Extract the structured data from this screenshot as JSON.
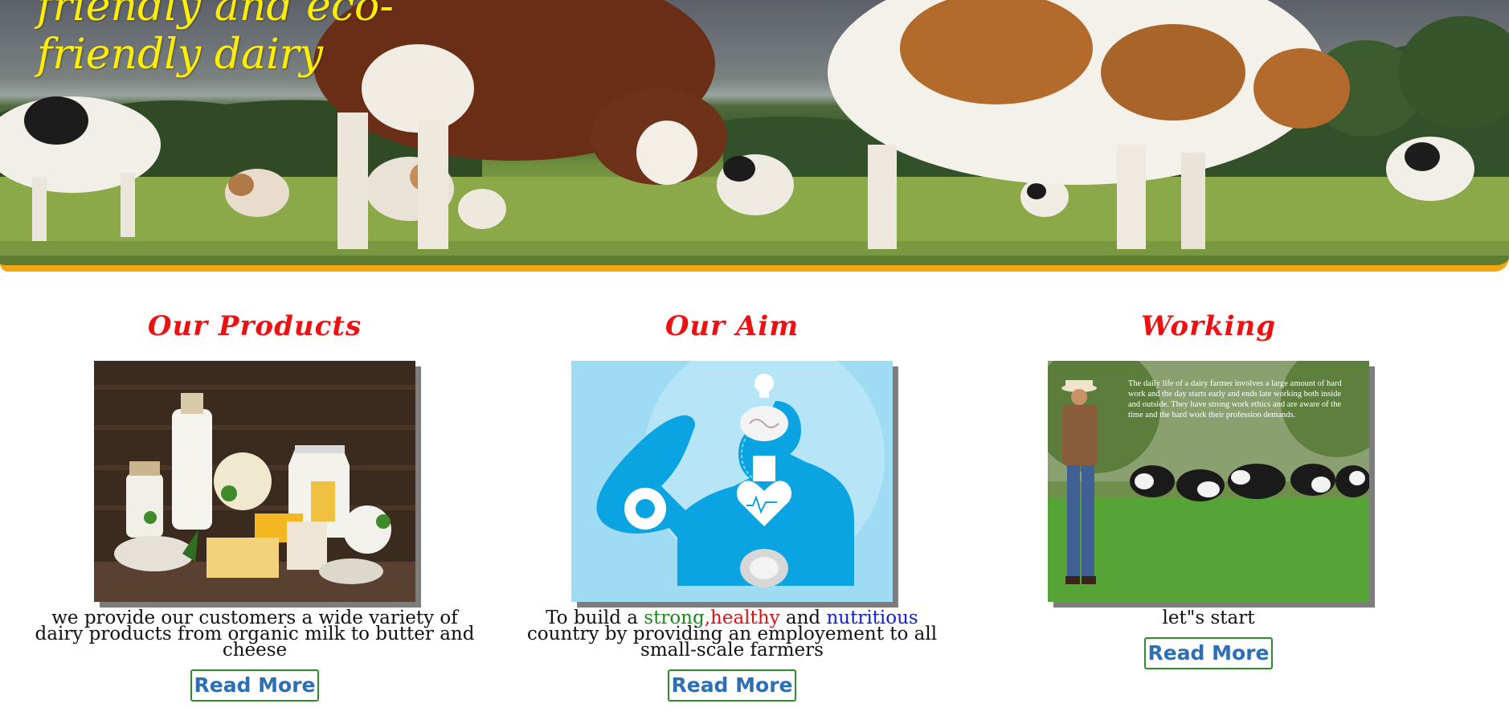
{
  "hero": {
    "title": "friendly and eco-friendly dairy",
    "accent_color": "#f5a80f",
    "title_color": "#ffee00"
  },
  "cards": [
    {
      "title": "Our Products",
      "image": "dairy-products-photo",
      "text": "we provide our customers a wide variety of dairy products from organic milk to butter and cheese",
      "button": "Read More"
    },
    {
      "title": "Our Aim",
      "image": "healthy-body-illustration",
      "text_parts": {
        "before": "To build a",
        "strong": "strong",
        "comma": ",",
        "healthy": "healthy",
        "and": "and",
        "nutritious": "nutritious",
        "after": "country by providing an employement to all small-scale farmers"
      },
      "button": "Read More"
    },
    {
      "title": "Working",
      "image": "farmer-with-cows-photo",
      "image_caption": "The daily life of a dairy farmer involves a large amount of hard work and the day starts early and ends late working both inside and outside. They have strong work ethics and are aware of the time and the hard work their profession demands.",
      "text": "let\"s start",
      "button": "Read More"
    }
  ],
  "colors": {
    "card_title": "#ee1111",
    "button_text": "#2d6fb5",
    "button_border": "#2e8b2e",
    "strong": "#1a8a1a",
    "healthy": "#e01010",
    "nutritious": "#1020d0"
  }
}
